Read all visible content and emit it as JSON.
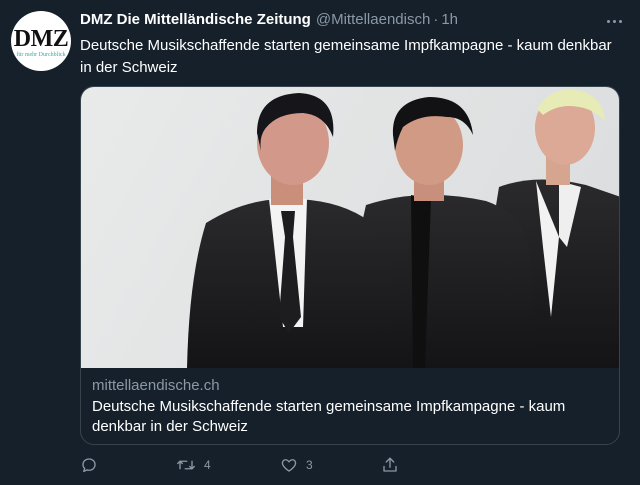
{
  "account": {
    "display_name": "DMZ Die Mittelländische Zeitung",
    "handle": "@Mittellaendisch",
    "separator": "·",
    "time": "1h",
    "avatar_text": "DMZ",
    "avatar_subtext": "für mehr Durchblick"
  },
  "tweet": {
    "text": "Deutsche Musikschaffende starten gemeinsame Impfkampagne - kaum denkbar in der Schweiz"
  },
  "card": {
    "domain": "mittellaendische.ch",
    "title": "Deutsche Musikschaffende starten gemeinsame Impfkampagne - kaum denkbar in der Schweiz"
  },
  "actions": {
    "reply_count": "",
    "retweet_count": "4",
    "like_count": "3"
  },
  "icons": {
    "more": "more-icon",
    "reply": "reply-icon",
    "retweet": "retweet-icon",
    "like": "heart-icon",
    "share": "share-icon"
  },
  "colors": {
    "background": "#15202b",
    "secondary_text": "#8b98a5",
    "border": "#38444d"
  }
}
